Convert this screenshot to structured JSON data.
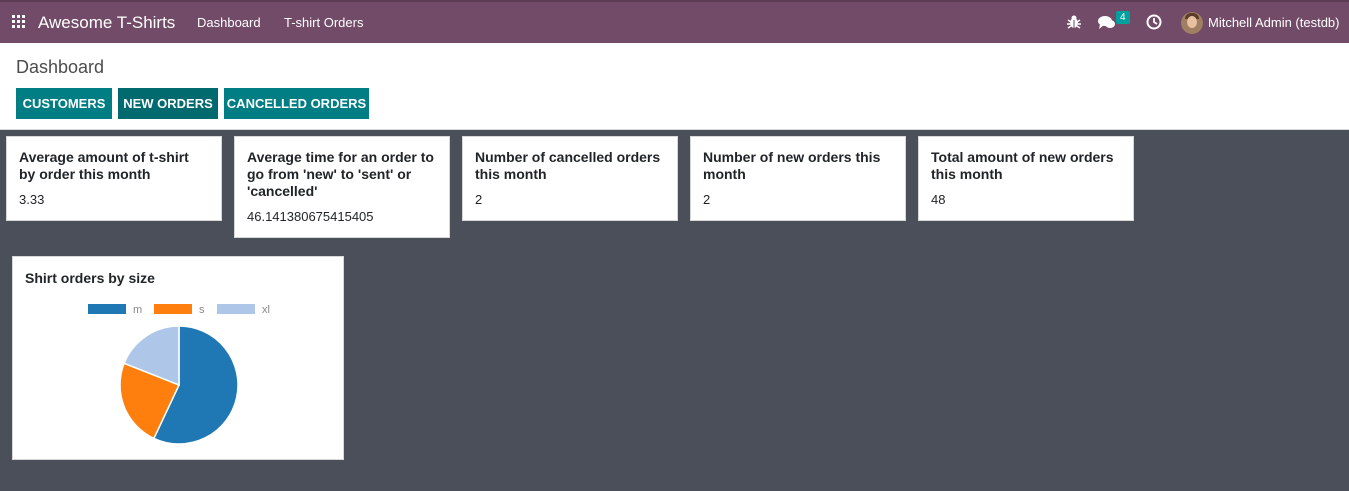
{
  "navbar": {
    "app_title": "Awesome T-Shirts",
    "links": [
      "Dashboard",
      "T-shirt Orders"
    ],
    "messages_count": "4",
    "user": "Mitchell Admin (testdb)",
    "colors": {
      "bar": "#714b67",
      "badge": "#00a09d"
    }
  },
  "page": {
    "title": "Dashboard",
    "buttons": [
      "CUSTOMERS",
      "NEW ORDERS",
      "CANCELLED ORDERS"
    ]
  },
  "stats": [
    {
      "title": "Average amount of t-shirt by order this month",
      "value": "3.33"
    },
    {
      "title": "Average time for an order to go from 'new' to 'sent' or 'cancelled'",
      "value": "46.141380675415405"
    },
    {
      "title": "Number of cancelled orders this month",
      "value": "2"
    },
    {
      "title": "Number of new orders this month",
      "value": "2"
    },
    {
      "title": "Total amount of new orders this month",
      "value": "48"
    }
  ],
  "chart_data": {
    "type": "pie",
    "title": "Shirt orders by size",
    "categories": [
      "m",
      "s",
      "xl"
    ],
    "values": [
      57,
      24,
      19
    ],
    "colors": [
      "#1f77b4",
      "#ff7f0e",
      "#aec7e8"
    ],
    "legend": "top"
  }
}
